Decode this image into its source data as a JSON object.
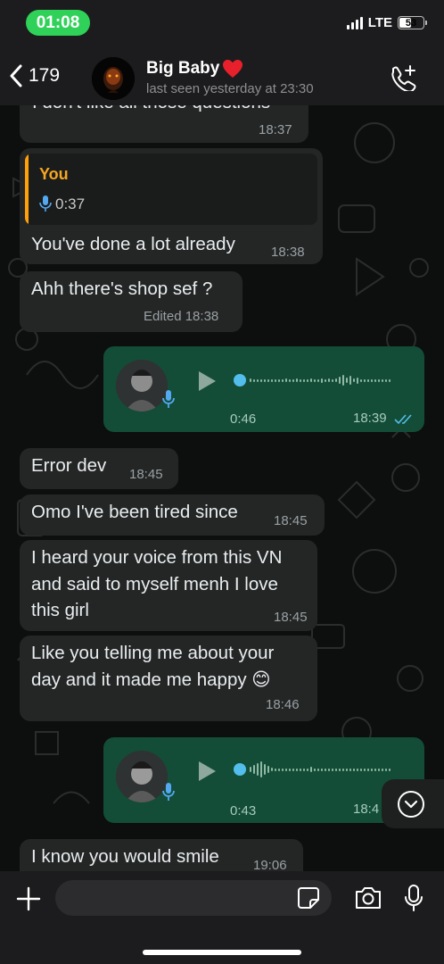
{
  "status_bar": {
    "time": "01:08",
    "network": "LTE",
    "battery": "53",
    "battery_level": 0.53
  },
  "header": {
    "back_count": "179",
    "contact_name": "Big Baby",
    "emoji": "❤️",
    "last_seen": "last seen yesterday at 23:30",
    "icons": {
      "back": "chevron-left-icon",
      "call": "add-call-icon"
    }
  },
  "messages": {
    "m0": {
      "text": "I don't like all those questions",
      "time": "18:37"
    },
    "m1": {
      "quote_sender": "You",
      "quote_duration": "0:37",
      "text": "You've done a lot already",
      "time": "18:38"
    },
    "m2": {
      "text": "Ahh there's shop sef ?",
      "edited": "Edited",
      "time": "18:38"
    },
    "voice1": {
      "duration": "0:46",
      "time": "18:39"
    },
    "m3": {
      "text": "Error dev",
      "time": "18:45"
    },
    "m4": {
      "text": "Omo I've been tired since",
      "time": "18:45"
    },
    "m5": {
      "line1": "I heard your voice from this VN",
      "line2": "and said to myself menh I love",
      "line3": "this girl",
      "time": "18:45"
    },
    "m6": {
      "line1": "Like you telling me about your",
      "line2": "day and it made me happy 😊",
      "time": "18:46"
    },
    "voice2": {
      "duration": "0:43",
      "time": "18:4"
    },
    "m7": {
      "text": "I know you would smile",
      "time": "19:06"
    }
  },
  "composer": {
    "placeholder": "",
    "icons": [
      "plus-icon",
      "sticker-icon",
      "camera-icon",
      "microphone-icon"
    ]
  },
  "colors": {
    "incoming_bubble": "#242626",
    "outgoing_bubble": "#134d37",
    "accent_green": "#2fd158",
    "quote_orange": "#ff9f0a",
    "read_ticks": "#53bdeb"
  }
}
